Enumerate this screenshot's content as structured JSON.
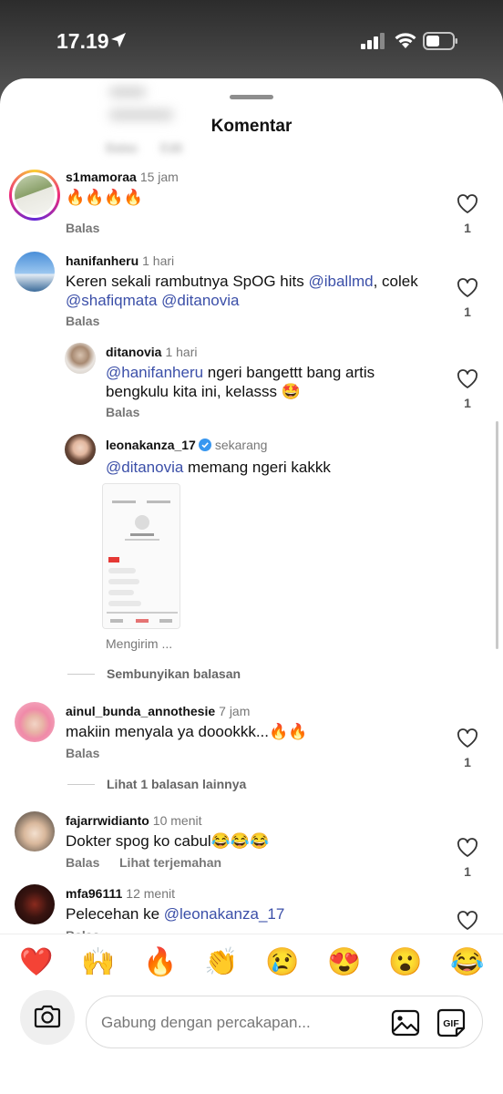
{
  "status": {
    "time": "17.19"
  },
  "header": {
    "title": "Komentar",
    "ghost_reply": "Balas",
    "ghost_edit": "Edit"
  },
  "comments": [
    {
      "user": "s1mamoraa",
      "time": "15 jam",
      "text": "🔥🔥🔥🔥",
      "reply": "Balas",
      "likes": "1"
    },
    {
      "user": "hanifanheru",
      "time": "1 hari",
      "text_prefix": "Keren sekali rambutnya SpOG hits ",
      "mention1": "@iballmd",
      "text_mid": ", colek ",
      "mention2": "@shafiqmata",
      "mention3": "@ditanovia",
      "reply": "Balas",
      "likes": "1"
    },
    {
      "user": "ditanovia",
      "time": "1 hari",
      "mention": "@hanifanheru",
      "text": " ngeri bangettt bang artis bengkulu kita ini, kelasss 🤩",
      "reply": "Balas",
      "likes": "1"
    },
    {
      "user": "leonakanza_17",
      "time": "sekarang",
      "mention": "@ditanovia",
      "text": " memang ngeri kakkk",
      "status": "Mengirim ..."
    },
    {
      "user": "ainul_bunda_annothesie",
      "time": "7 jam",
      "text": "makiin menyala ya doookkk...🔥🔥",
      "reply": "Balas",
      "likes": "1"
    },
    {
      "user": "fajarrwidianto",
      "time": "10 menit",
      "text": "Dokter spog ko cabul😂😂😂",
      "reply": "Balas",
      "translate": "Lihat terjemahan",
      "likes": "1"
    },
    {
      "user": "mfa96111",
      "time": "12 menit",
      "text_prefix": "Pelecehan ke ",
      "mention": "@leonakanza_17",
      "reply": "Balas"
    }
  ],
  "threads": {
    "hide_replies": "Sembunyikan balasan",
    "more_replies": "Lihat 1 balasan lainnya"
  },
  "emojis": [
    "❤️",
    "🙌",
    "🔥",
    "👏",
    "😢",
    "😍",
    "😮",
    "😂"
  ],
  "composer": {
    "placeholder": "Gabung dengan percakapan..."
  },
  "colors": {
    "mention": "#3b4fa8",
    "accent_ring": "#ee2a7b",
    "verified": "#3897f0"
  }
}
